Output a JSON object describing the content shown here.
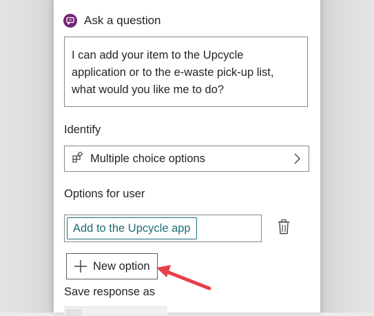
{
  "node": {
    "title": "Ask a question",
    "icon": "chat-question-icon",
    "accent_color": "#742774"
  },
  "question": {
    "text": "I can add your item to the Upcycle application or to the e-waste pick-up list, what would you like me to do?"
  },
  "identify": {
    "label": "Identify",
    "selected": "Multiple choice options",
    "icon": "shapes-icon",
    "chevron_icon": "chevron-right-icon"
  },
  "options": {
    "label": "Options for user",
    "items": [
      "Add to the Upcycle app"
    ],
    "option_color": "#1b6d74",
    "delete_icon": "trash-icon"
  },
  "new_option": {
    "label": "New option",
    "icon": "plus-icon"
  },
  "save": {
    "label": "Save response as"
  },
  "annotation": {
    "arrow_color": "#e8404a"
  }
}
